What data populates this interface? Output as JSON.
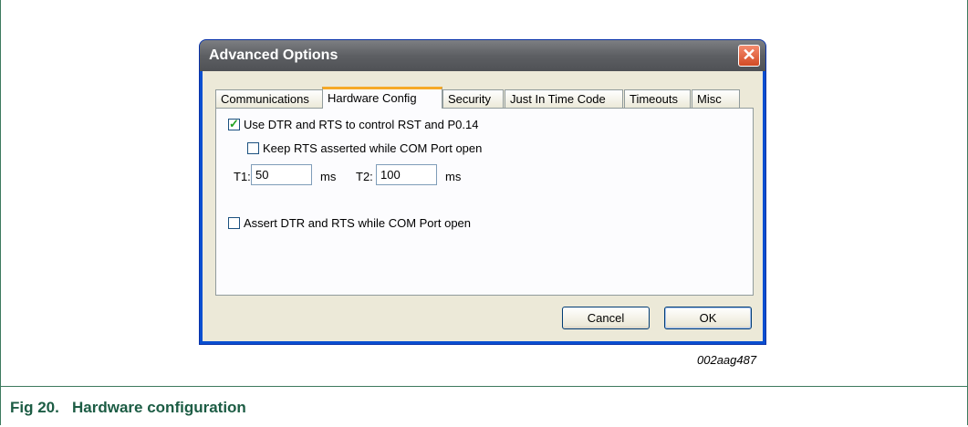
{
  "window": {
    "title": "Advanced Options",
    "close_glyph": "✕"
  },
  "tabs": [
    {
      "label": "Communications",
      "active": false
    },
    {
      "label": "Hardware Config",
      "active": true
    },
    {
      "label": "Security",
      "active": false
    },
    {
      "label": "Just In Time Code",
      "active": false
    },
    {
      "label": "Timeouts",
      "active": false
    },
    {
      "label": "Misc",
      "active": false
    }
  ],
  "options": {
    "use_dtr_rts": {
      "label": "Use DTR and RTS to control RST and P0.14",
      "checked": true
    },
    "keep_rts": {
      "label": "Keep RTS asserted while COM Port open",
      "checked": false
    },
    "t1": {
      "label": "T1:",
      "value": "50",
      "unit": "ms"
    },
    "t2": {
      "label": "T2:",
      "value": "100",
      "unit": "ms"
    },
    "assert_dtr_rts": {
      "label": "Assert DTR and RTS while COM Port open",
      "checked": false
    }
  },
  "buttons": {
    "cancel": "Cancel",
    "ok": "OK"
  },
  "figure": {
    "id": "002aag487",
    "caption": "Fig 20.   Hardware configuration"
  },
  "colors": {
    "title_bar": "#5d5f63",
    "caption": "#1c5c44",
    "tab_highlight": "#f5a927",
    "dialog_bg": "#ece9d8"
  }
}
